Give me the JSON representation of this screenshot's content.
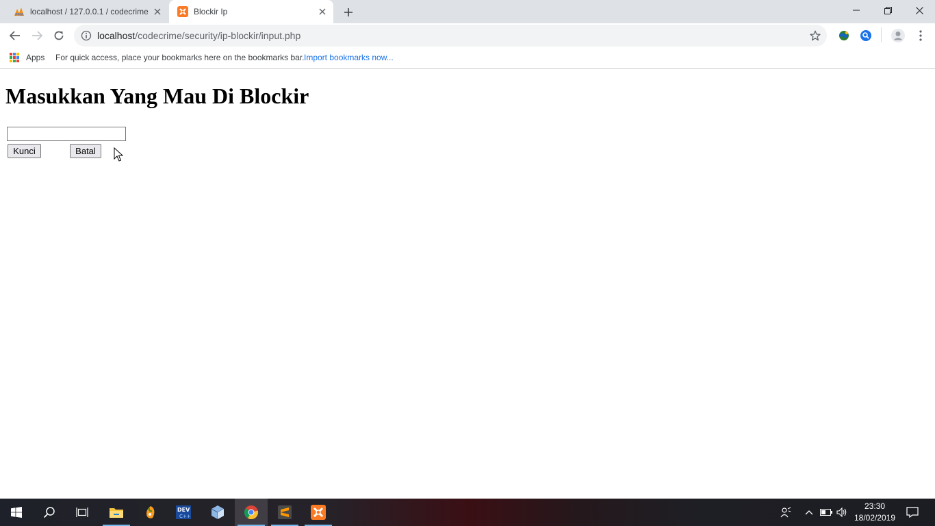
{
  "browser": {
    "tabs": [
      {
        "title": "localhost / 127.0.0.1 / codecrime",
        "favicon": "phpmyadmin-icon"
      },
      {
        "title": "Blockir Ip",
        "favicon": "xampp-icon"
      }
    ],
    "url_host": "localhost",
    "url_path": "/codecrime/security/ip-blockir/input.php",
    "bookmarks_apps_label": "Apps",
    "bookmarks_hint": "For quick access, place your bookmarks here on the bookmarks bar.",
    "bookmarks_import_label": "Import bookmarks now..."
  },
  "page": {
    "heading": "Masukkan Yang Mau Di Blockir",
    "input_value": "",
    "submit_label": "Kunci",
    "cancel_label": "Batal"
  },
  "taskbar": {
    "apps": [
      "start-icon",
      "search-icon",
      "task-view-icon",
      "file-explorer-icon",
      "fl-studio-icon",
      "dev-cpp-icon",
      "virtualbox-icon",
      "chrome-icon",
      "sublime-text-icon",
      "xampp-icon"
    ],
    "time": "23:30",
    "date": "18/02/2019"
  },
  "colors": {
    "tabstrip": "#dee1e6",
    "link": "#1a73e8",
    "xampp_orange": "#fb7a24",
    "taskbar_accent": "#76b9ed"
  }
}
